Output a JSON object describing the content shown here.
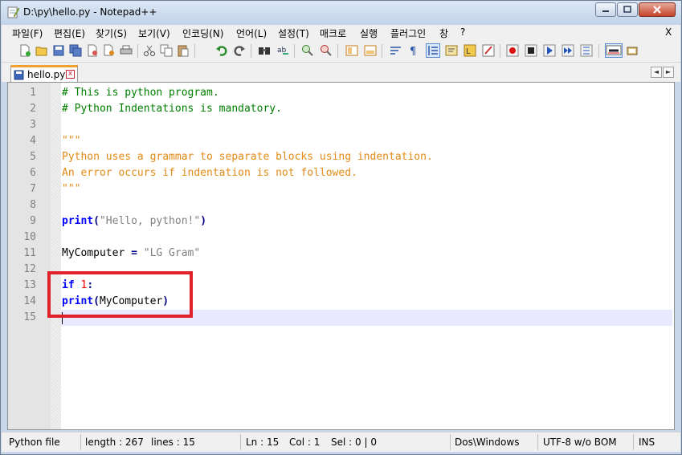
{
  "window": {
    "title": "D:\\py\\hello.py - Notepad++",
    "controls": {
      "minimize": "_",
      "maximize": "□",
      "close": "X"
    }
  },
  "menu": {
    "items": [
      "파일(F)",
      "편집(E)",
      "찾기(S)",
      "보기(V)",
      "인코딩(N)",
      "언어(L)",
      "설정(T)",
      "매크로",
      "실행",
      "플러그인",
      "창",
      "?"
    ],
    "close": "X"
  },
  "toolbar": {
    "icons": [
      "new-file-icon",
      "open-file-icon",
      "save-icon",
      "save-all-icon",
      "close-icon",
      "close-all-icon",
      "print-icon",
      "cut-icon",
      "copy-icon",
      "paste-icon",
      "undo-icon",
      "redo-icon",
      "find-icon",
      "replace-icon",
      "zoom-in-icon",
      "zoom-out-icon",
      "sync-vertical-icon",
      "sync-horizontal-icon",
      "word-wrap-icon",
      "show-all-chars-icon",
      "indent-guide-icon",
      "doc-map-icon",
      "function-list-icon",
      "folder-as-workspace-icon",
      "record-macro-icon",
      "stop-record-icon",
      "play-macro-icon",
      "run-macro-multiple-icon",
      "save-macro-icon",
      "spell-check-icon",
      "lang-icon"
    ]
  },
  "tabs": [
    {
      "label": "hello.py",
      "active": true
    }
  ],
  "tab_nav": {
    "prev": "◄",
    "next": "►"
  },
  "editor": {
    "current_line": 15,
    "lines": [
      {
        "n": "1",
        "segments": [
          {
            "text": "# This is python program.",
            "cls": "cmt"
          }
        ]
      },
      {
        "n": "2",
        "segments": [
          {
            "text": "# Python Indentations is mandatory.",
            "cls": "cmt"
          }
        ]
      },
      {
        "n": "3",
        "segments": []
      },
      {
        "n": "4",
        "segments": [
          {
            "text": "\"\"\"",
            "cls": "str"
          }
        ]
      },
      {
        "n": "5",
        "segments": [
          {
            "text": "Python uses a grammar to separate blocks using indentation.",
            "cls": "str"
          }
        ]
      },
      {
        "n": "6",
        "segments": [
          {
            "text": "An error occurs if indentation is not followed.",
            "cls": "str"
          }
        ]
      },
      {
        "n": "7",
        "segments": [
          {
            "text": "\"\"\"",
            "cls": "str"
          }
        ]
      },
      {
        "n": "8",
        "segments": []
      },
      {
        "n": "9",
        "segments": [
          {
            "text": "print",
            "cls": "kw"
          },
          {
            "text": "(",
            "cls": "op"
          },
          {
            "text": "\"Hello, python!\"",
            "cls": "dstr"
          },
          {
            "text": ")",
            "cls": "op"
          }
        ]
      },
      {
        "n": "10",
        "segments": []
      },
      {
        "n": "11",
        "segments": [
          {
            "text": "MyComputer ",
            "cls": "plain"
          },
          {
            "text": "=",
            "cls": "op"
          },
          {
            "text": " \"LG Gram\"",
            "cls": "dstr"
          }
        ]
      },
      {
        "n": "12",
        "segments": []
      },
      {
        "n": "13",
        "segments": [
          {
            "text": "if",
            "cls": "kw"
          },
          {
            "text": " ",
            "cls": "plain"
          },
          {
            "text": "1",
            "cls": "num"
          },
          {
            "text": ":",
            "cls": "op"
          }
        ]
      },
      {
        "n": "14",
        "segments": [
          {
            "text": "print",
            "cls": "kw"
          },
          {
            "text": "(",
            "cls": "op"
          },
          {
            "text": "MyComputer",
            "cls": "plain"
          },
          {
            "text": ")",
            "cls": "op"
          }
        ]
      },
      {
        "n": "15",
        "segments": []
      }
    ]
  },
  "status": {
    "file_type": "Python file",
    "length": "length : 267",
    "lines": "lines : 15",
    "ln": "Ln : 15",
    "col": "Col : 1",
    "sel": "Sel : 0 | 0",
    "eol": "Dos\\Windows",
    "encoding": "UTF-8 w/o BOM",
    "mode": "INS"
  },
  "colors": {
    "comment": "#008000",
    "string": "#e38b16",
    "keyword": "#0000ff",
    "number": "#ff0000",
    "annotation": "#e0202a",
    "current_line": "#e8e8ff"
  }
}
